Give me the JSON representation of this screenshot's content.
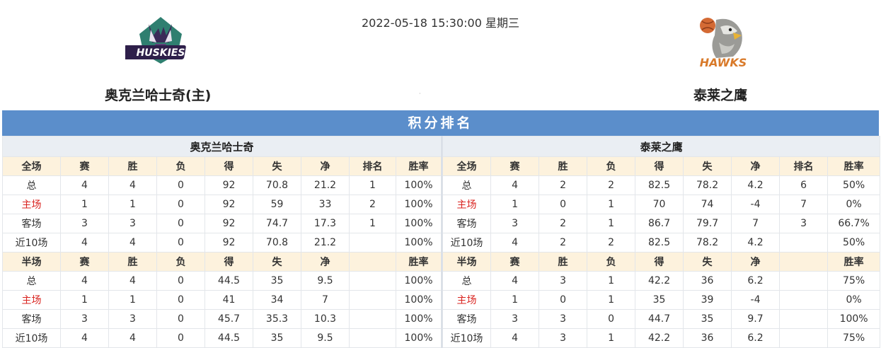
{
  "header": {
    "datetime": "2022-05-18 15:30:00 星期三",
    "home_team": "奥克兰哈士奇(主)",
    "away_team": "泰莱之鹰",
    "home_logo_text": "HUSKIES",
    "away_logo_text": "HAWKS"
  },
  "standings": {
    "title": "积分排名",
    "home": {
      "team": "奥克兰哈士奇",
      "full_cols": [
        "全场",
        "赛",
        "胜",
        "负",
        "得",
        "失",
        "净",
        "排名",
        "胜率"
      ],
      "full_rows": [
        [
          "总",
          "4",
          "4",
          "0",
          "92",
          "70.8",
          "21.2",
          "1",
          "100%"
        ],
        [
          "主场",
          "1",
          "1",
          "0",
          "92",
          "59",
          "33",
          "2",
          "100%"
        ],
        [
          "客场",
          "3",
          "3",
          "0",
          "92",
          "74.7",
          "17.3",
          "1",
          "100%"
        ],
        [
          "近10场",
          "4",
          "4",
          "0",
          "92",
          "70.8",
          "21.2",
          "",
          "100%"
        ]
      ],
      "half_cols": [
        "半场",
        "赛",
        "胜",
        "负",
        "得",
        "失",
        "净",
        "",
        "胜率"
      ],
      "half_rows": [
        [
          "总",
          "4",
          "4",
          "0",
          "44.5",
          "35",
          "9.5",
          "",
          "100%"
        ],
        [
          "主场",
          "1",
          "1",
          "0",
          "41",
          "34",
          "7",
          "",
          "100%"
        ],
        [
          "客场",
          "3",
          "3",
          "0",
          "45.7",
          "35.3",
          "10.3",
          "",
          "100%"
        ],
        [
          "近10场",
          "4",
          "4",
          "0",
          "44.5",
          "35",
          "9.5",
          "",
          "100%"
        ]
      ]
    },
    "away": {
      "team": "泰莱之鹰",
      "full_cols": [
        "全场",
        "赛",
        "胜",
        "负",
        "得",
        "失",
        "净",
        "排名",
        "胜率"
      ],
      "full_rows": [
        [
          "总",
          "4",
          "2",
          "2",
          "82.5",
          "78.2",
          "4.2",
          "6",
          "50%"
        ],
        [
          "主场",
          "1",
          "0",
          "1",
          "70",
          "74",
          "-4",
          "7",
          "0%"
        ],
        [
          "客场",
          "3",
          "2",
          "1",
          "86.7",
          "79.7",
          "7",
          "3",
          "66.7%"
        ],
        [
          "近10场",
          "4",
          "2",
          "2",
          "82.5",
          "78.2",
          "4.2",
          "",
          "50%"
        ]
      ],
      "half_cols": [
        "半场",
        "赛",
        "胜",
        "负",
        "得",
        "失",
        "净",
        "",
        "胜率"
      ],
      "half_rows": [
        [
          "总",
          "4",
          "3",
          "1",
          "42.2",
          "36",
          "6.2",
          "",
          "75%"
        ],
        [
          "主场",
          "1",
          "0",
          "1",
          "35",
          "39",
          "-4",
          "",
          "0%"
        ],
        [
          "客场",
          "3",
          "3",
          "0",
          "44.7",
          "35",
          "9.7",
          "",
          "100%"
        ],
        [
          "近10场",
          "4",
          "3",
          "1",
          "42.2",
          "36",
          "6.2",
          "",
          "75%"
        ]
      ]
    },
    "colors": {
      "banner": "#5b8ecb",
      "header_row": "#fdf2dd",
      "team_row": "#eaeef3",
      "home_label": "#d9231f"
    }
  }
}
